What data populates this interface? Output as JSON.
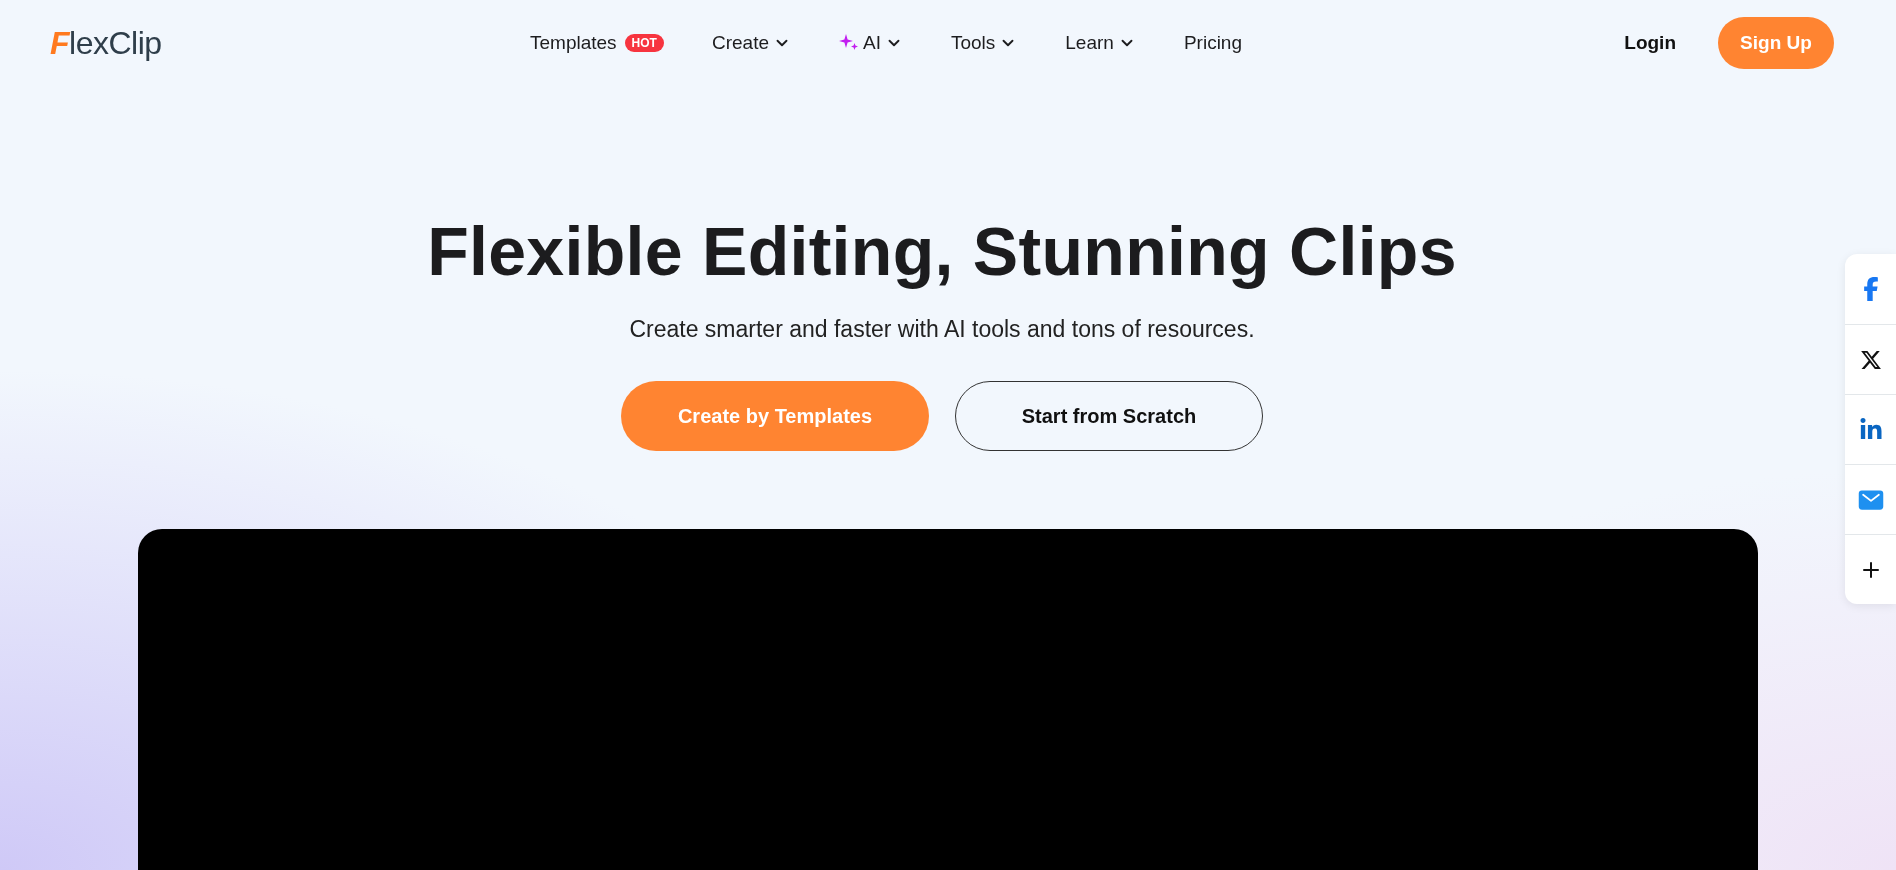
{
  "logo": {
    "mark": "F",
    "text": "lexClip"
  },
  "nav": [
    {
      "label": "Templates",
      "badge": "HOT",
      "dropdown": false,
      "sparkle": false
    },
    {
      "label": "Create",
      "dropdown": true,
      "sparkle": false
    },
    {
      "label": "AI",
      "dropdown": true,
      "sparkle": true
    },
    {
      "label": "Tools",
      "dropdown": true,
      "sparkle": false
    },
    {
      "label": "Learn",
      "dropdown": true,
      "sparkle": false
    },
    {
      "label": "Pricing",
      "dropdown": false,
      "sparkle": false
    }
  ],
  "login": "Login",
  "signup": "Sign Up",
  "hero": {
    "title": "Flexible Editing, Stunning Clips",
    "subtitle": "Create smarter and faster with AI tools and tons of resources.",
    "buttons": [
      {
        "label": "Create by Templates",
        "kind": "primary"
      },
      {
        "label": "Start from Scratch",
        "kind": "outline"
      }
    ]
  },
  "share": [
    {
      "kind": "facebook"
    },
    {
      "kind": "x"
    },
    {
      "kind": "linkedin"
    },
    {
      "kind": "email"
    },
    {
      "kind": "more"
    }
  ]
}
